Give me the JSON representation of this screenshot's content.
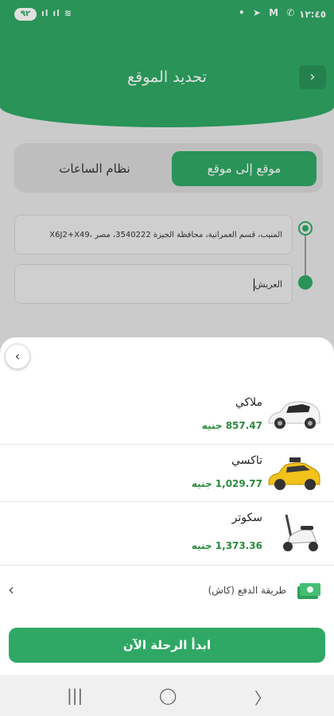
{
  "status": {
    "time": "١٢:٤٥",
    "battery": "٩٢"
  },
  "header": {
    "title": "تحديد الموقع",
    "back_icon": "chevron-right-icon"
  },
  "tabs": {
    "active": "موقع إلى موقع",
    "other": "نظام الساعات"
  },
  "route": {
    "from": "المنيب، قسم العمرانية، محافظة الجيزة 3540222، مصر ،X6J2+X49",
    "to": "العريش"
  },
  "options": [
    {
      "name": "ملاكي",
      "price": "857.47 جنيه",
      "icon": "car-icon"
    },
    {
      "name": "تاكسي",
      "price": "1,029.77 جنيه",
      "icon": "taxi-icon"
    },
    {
      "name": "سكوتر",
      "price": "1,373.36 جنيه",
      "icon": "scooter-icon"
    }
  ],
  "payment": {
    "label": "طريقة الدفع (كاش)",
    "icon": "cash-icon"
  },
  "start_label": "ابدأ الرحلة الآن",
  "colors": {
    "primary": "#2fa865",
    "price": "#2a8a3e"
  }
}
